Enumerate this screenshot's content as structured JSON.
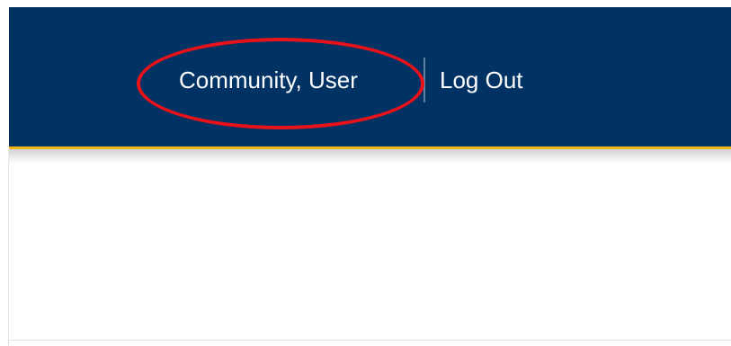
{
  "header": {
    "user_name": "Community, User",
    "logout_label": "Log Out"
  },
  "colors": {
    "header_bg": "#003264",
    "accent_gold": "#f2b619",
    "highlight_red": "#e8131a",
    "text": "#ffffff"
  }
}
